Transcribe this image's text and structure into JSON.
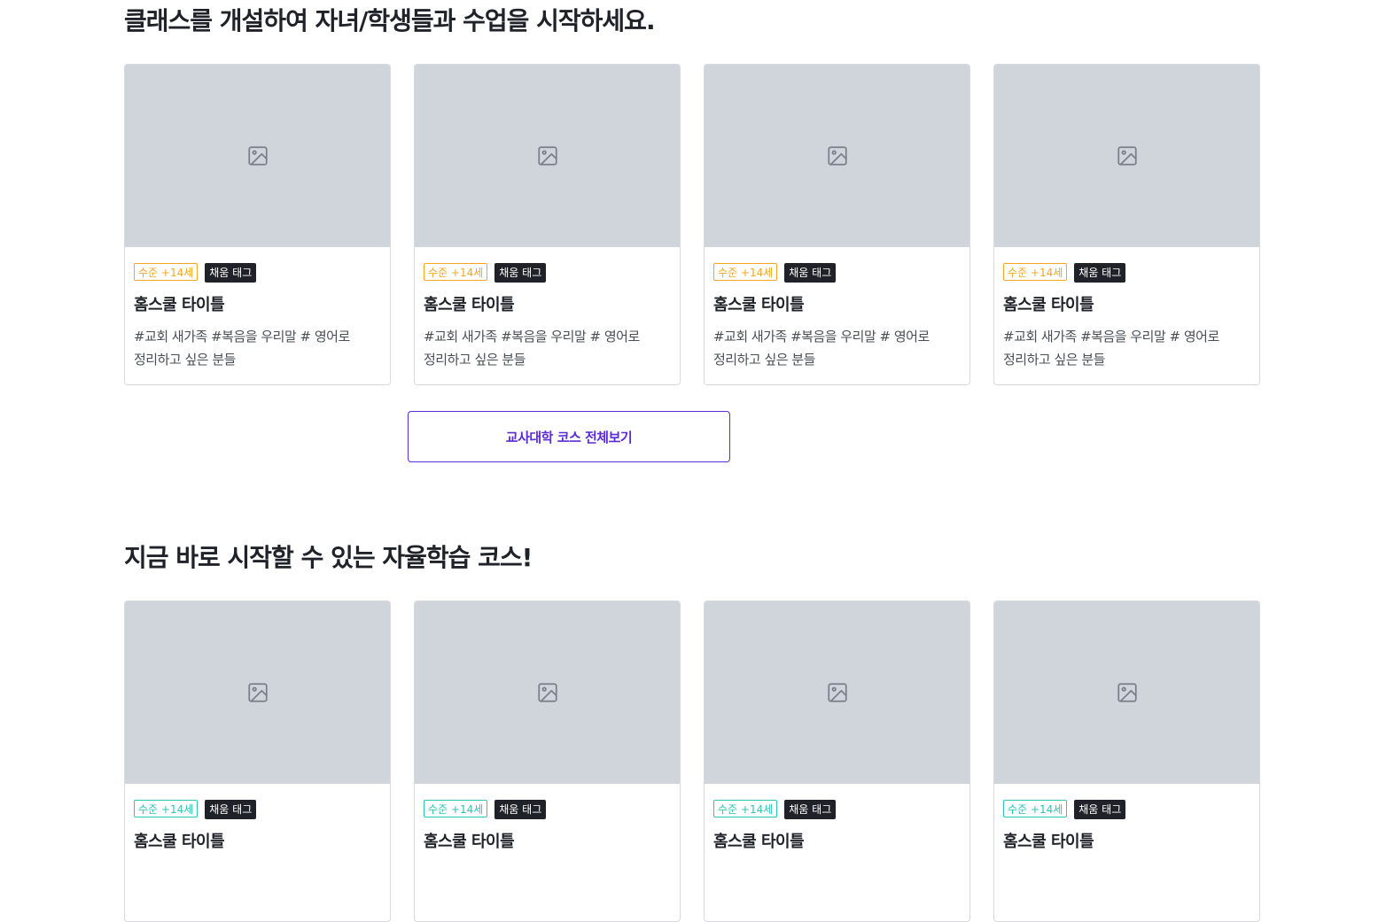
{
  "section1": {
    "title": "클래스를 개설하여 자녀/학생들과 수업을 시작하세요.",
    "cards": [
      {
        "level": "수준 +14세",
        "tag": "채움 태그",
        "title": "홈스쿨 타이틀",
        "desc_line1": "#교회 새가족 #복음을 우리말 # 영어로",
        "desc_line2": "정리하고 싶은 분들"
      },
      {
        "level": "수준 +14세",
        "tag": "채움 태그",
        "title": "홈스쿨 타이틀",
        "desc_line1": "#교회 새가족 #복음을 우리말 # 영어로",
        "desc_line2": "정리하고 싶은 분들"
      },
      {
        "level": "수준 +14세",
        "tag": "채움 태그",
        "title": "홈스쿨 타이틀",
        "desc_line1": "#교회 새가족 #복음을 우리말 # 영어로",
        "desc_line2": "정리하고 싶은 분들"
      },
      {
        "level": "수준 +14세",
        "tag": "채움 태그",
        "title": "홈스쿨 타이틀",
        "desc_line1": "#교회 새가족 #복음을 우리말 # 영어로",
        "desc_line2": "정리하고 싶은 분들"
      }
    ],
    "more_button": "교사대학 코스 전체보기"
  },
  "section2": {
    "title": "지금 바로 시작할 수 있는 자율학습 코스!",
    "cards": [
      {
        "level": "수준 +14세",
        "tag": "채움 태그",
        "title": "홈스쿨 타이틀"
      },
      {
        "level": "수준 +14세",
        "tag": "채움 태그",
        "title": "홈스쿨 타이틀"
      },
      {
        "level": "수준 +14세",
        "tag": "채움 태그",
        "title": "홈스쿨 타이틀"
      },
      {
        "level": "수준 +14세",
        "tag": "채움 태그",
        "title": "홈스쿨 타이틀"
      }
    ]
  },
  "colors": {
    "level_tag_section1": "#f5a623",
    "level_tag_section2": "#2ec4b6",
    "accent": "#5b2bd6",
    "thumbnail_placeholder": "#d0d4db"
  },
  "icons": {
    "thumbnail": "image-placeholder-icon"
  }
}
